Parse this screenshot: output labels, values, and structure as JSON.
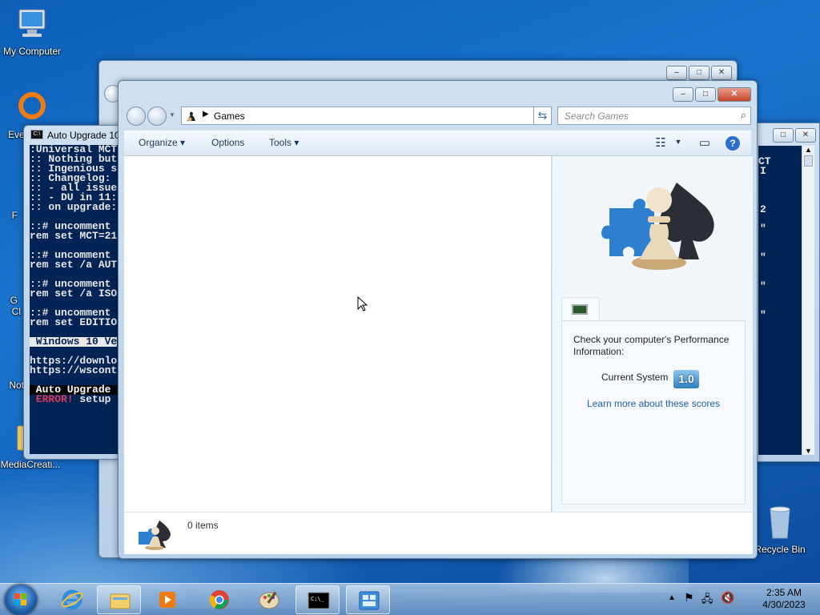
{
  "desktop": {
    "icons": {
      "my_computer": "My Computer",
      "recycle_bin": "Recycle Bin",
      "media_creation": "MediaCreati...",
      "partial_eve": "Eve",
      "partial_f": "F",
      "partial_g": "G",
      "partial_cl": "Cl",
      "partial_not": "Not"
    }
  },
  "console": {
    "title": "Auto Upgrade 10",
    "lines": [
      ":Universal MCT",
      ":: Nothing but",
      ":: Ingenious s",
      ":: Changelog:",
      ":: - all issue",
      ":: - DU in 11:",
      ":: on upgrade:",
      "",
      "::# uncomment",
      "rem set MCT=21",
      "",
      "::# uncomment",
      "rem set /a AUT",
      "",
      "::# uncomment",
      "rem set /a ISO",
      "",
      "::# uncomment",
      "rem set EDITIO",
      ""
    ],
    "banner": " Windows 10 Ve",
    "urls": [
      "https://downlo",
      "https://wscont"
    ],
    "status_banner": " Auto Upgrade ",
    "error_label": " ERROR!",
    "error_text": " setup"
  },
  "right_console": {
    "chars": [
      "CT",
      "I",
      "2",
      "\"",
      "\"",
      "\"",
      "\""
    ]
  },
  "games_window": {
    "address": "Games",
    "search_placeholder": "Search Games",
    "toolbar": {
      "organize": "Organize",
      "options": "Options",
      "tools": "Tools"
    },
    "preview": {
      "perf_text": "Check your computer's Performance Information:",
      "current_system_label": "Current System",
      "score": "1.0",
      "learn_more": "Learn more about these scores"
    },
    "details": {
      "item_count": "0 items"
    }
  },
  "taskbar": {
    "clock_time": "2:35 AM",
    "clock_date": "4/30/2023"
  }
}
